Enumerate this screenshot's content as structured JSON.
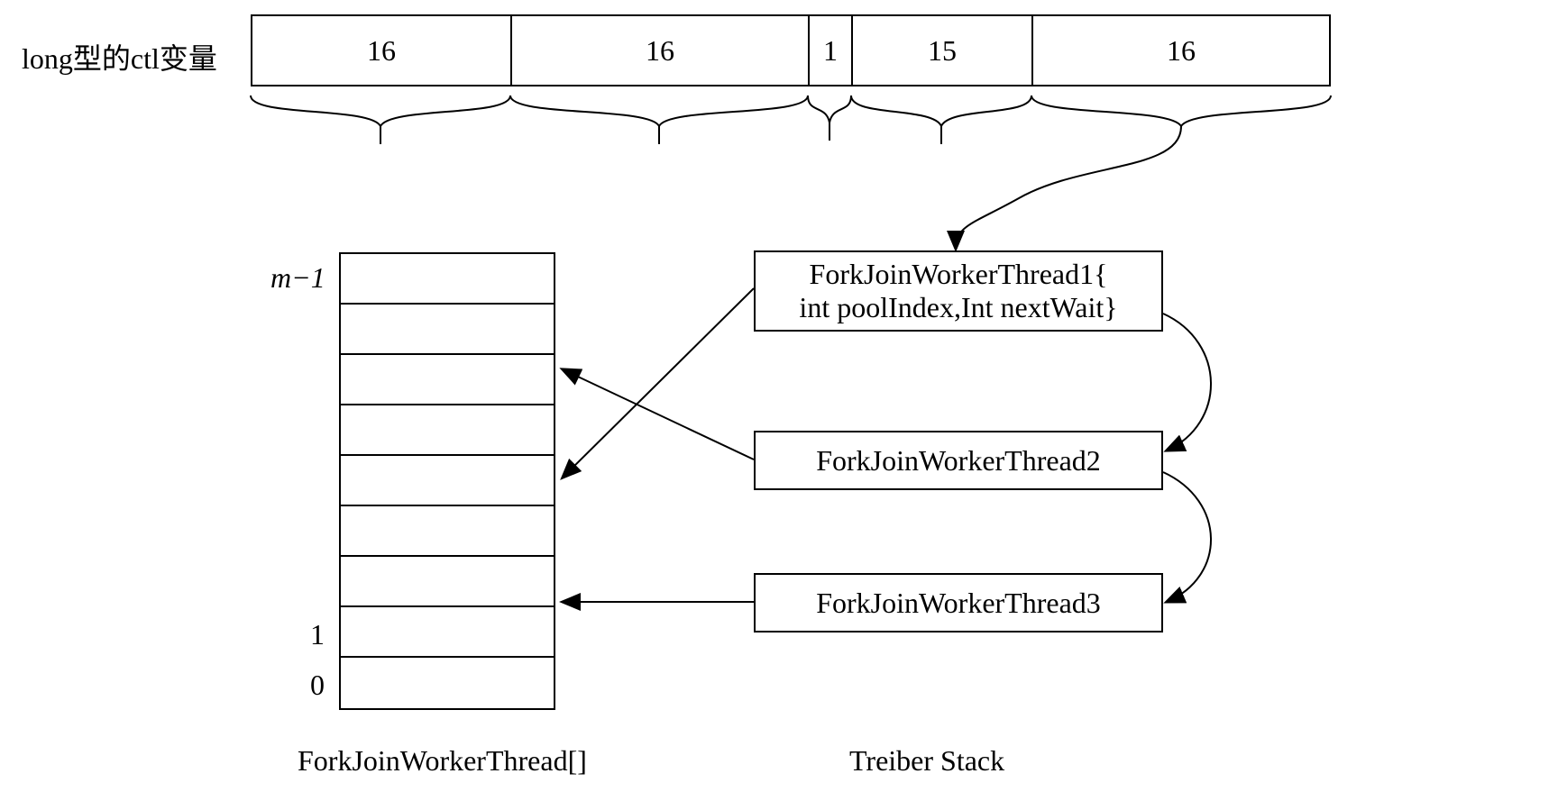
{
  "title_label": "long型的ctl变量",
  "bits": {
    "b1": "16",
    "b2": "16",
    "b3": "1",
    "b4": "15",
    "b5": "16"
  },
  "array": {
    "label": "ForkJoinWorkerThread[]",
    "idx_top": "m−1",
    "idx_1": "1",
    "idx_0": "0"
  },
  "stack": {
    "label": "Treiber Stack",
    "node1_line1": "ForkJoinWorkerThread1{",
    "node1_line2": "int poolIndex,Int nextWait}",
    "node2": "ForkJoinWorkerThread2",
    "node3": "ForkJoinWorkerThread3"
  }
}
